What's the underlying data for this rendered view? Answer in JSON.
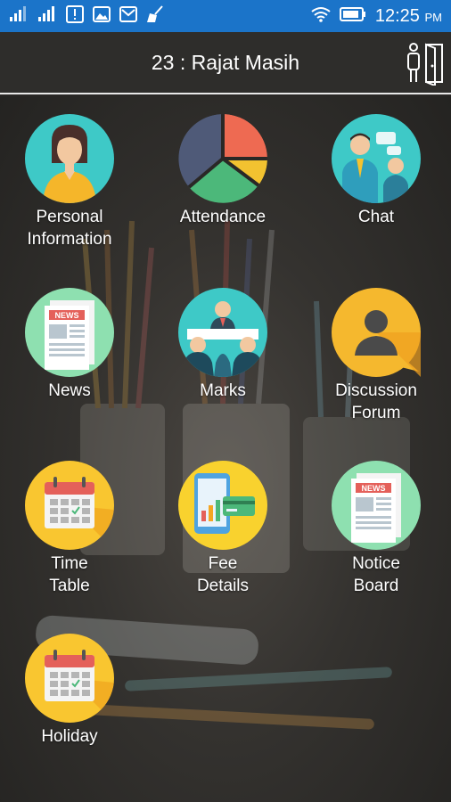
{
  "status_bar": {
    "time": "12:25",
    "ampm": "PM",
    "color": "#1b74c9"
  },
  "app_bar": {
    "title": "23 : Rajat Masih",
    "logout_icon": "logout-door-icon"
  },
  "menu": [
    {
      "id": "personal-information",
      "label": "Personal\nInformation",
      "icon": "person-icon",
      "color": "#3ec9c7"
    },
    {
      "id": "attendance",
      "label": "Attendance",
      "icon": "pie-chart-icon",
      "color": "#ffffff"
    },
    {
      "id": "chat",
      "label": "Chat",
      "icon": "chat-people-icon",
      "color": "#3ec9c7"
    },
    {
      "id": "news",
      "label": "News",
      "icon": "newspaper-icon",
      "color": "#8ee0b0"
    },
    {
      "id": "marks",
      "label": "Marks",
      "icon": "meeting-icon",
      "color": "#3ec9c7"
    },
    {
      "id": "discussion-forum",
      "label": "Discussion\nForum",
      "icon": "forum-speech-icon",
      "color": "#f5b82e"
    },
    {
      "id": "time-table",
      "label": "Time\nTable",
      "icon": "calendar-icon",
      "color": "#f9c630"
    },
    {
      "id": "fee-details",
      "label": "Fee\nDetails",
      "icon": "invoice-card-icon",
      "color": "#f9d22e"
    },
    {
      "id": "notice-board",
      "label": "Notice\nBoard",
      "icon": "notice-newspaper-icon",
      "color": "#8ee0b0"
    },
    {
      "id": "holiday",
      "label": "Holiday",
      "icon": "calendar-icon",
      "color": "#f9c630"
    }
  ],
  "newspaper_text": "NEWS"
}
